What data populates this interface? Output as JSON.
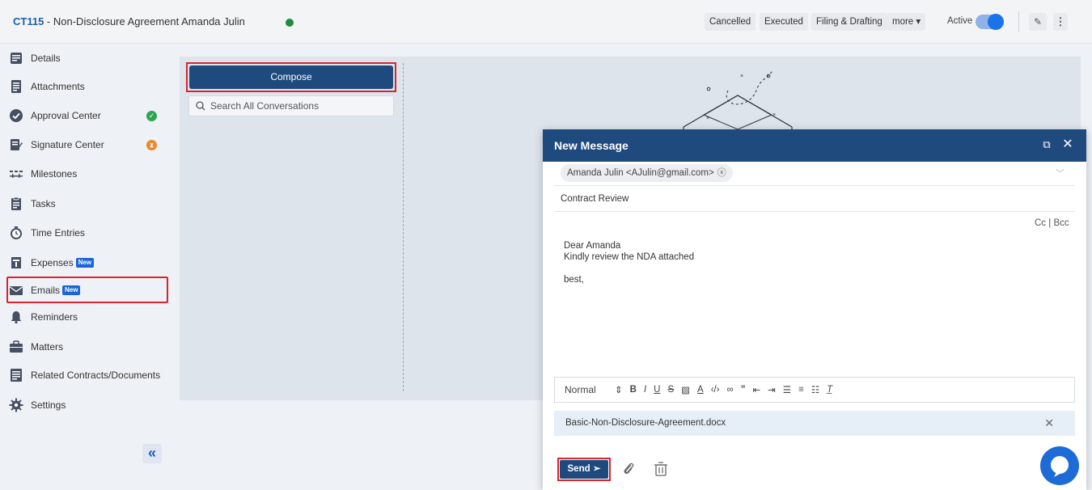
{
  "header": {
    "contract_id": "CT115",
    "separator": " - ",
    "contract_title": "Non-Disclosure Agreement Amanda Julin",
    "buttons": {
      "cancelled": "Cancelled",
      "executed": "Executed",
      "filing": "Filing & Drafting",
      "more": "more ▾"
    },
    "active_label": "Active",
    "status_dot_color": "#1e8e3e"
  },
  "sidebar": {
    "items": [
      {
        "label": "Details",
        "icon": "details-icon"
      },
      {
        "label": "Attachments",
        "icon": "attachments-icon"
      },
      {
        "label": "Approval Center",
        "icon": "approval-icon"
      },
      {
        "label": "Signature Center",
        "icon": "signature-icon"
      },
      {
        "label": "Milestones",
        "icon": "milestones-icon"
      },
      {
        "label": "Tasks",
        "icon": "tasks-icon"
      },
      {
        "label": "Time Entries",
        "icon": "clock-icon"
      },
      {
        "label": "Expenses",
        "icon": "expenses-icon"
      },
      {
        "label": "Emails",
        "icon": "envelope-icon"
      },
      {
        "label": "Reminders",
        "icon": "bell-icon"
      },
      {
        "label": "Matters",
        "icon": "briefcase-icon"
      },
      {
        "label": "Related Contracts/Documents",
        "icon": "documents-icon"
      },
      {
        "label": "Settings",
        "icon": "gear-icon"
      }
    ],
    "new_badge": "New",
    "collapse_glyph": "«"
  },
  "conversations": {
    "compose_label": "Compose",
    "search_placeholder": "Search All Conversations"
  },
  "modal": {
    "title": "New Message",
    "recipient": "Amanda Julin <AJulin@gmail.com>",
    "subject": "Contract Review",
    "cc": "Cc",
    "bcc": "Bcc",
    "body_lines": [
      "Dear Amanda",
      "Kindly review the NDA attached",
      "",
      "best,"
    ],
    "toolbar_style": "Normal",
    "attachment": "Basic-Non-Disclosure-Agreement.docx",
    "send_label": "Send"
  },
  "colors": {
    "primary": "#1e4a7e",
    "highlight": "#d9232f",
    "accent": "#1a73e8"
  }
}
